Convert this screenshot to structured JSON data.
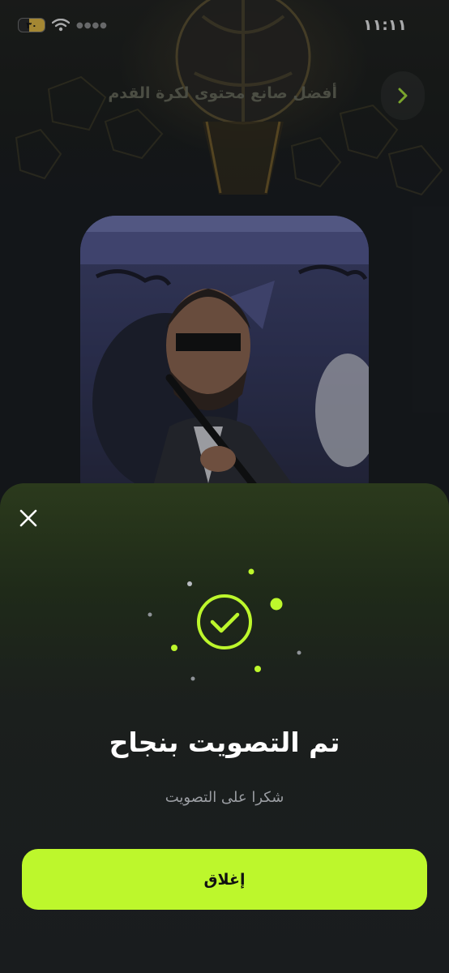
{
  "status_bar": {
    "time": "١١:١١",
    "battery": "٣٠",
    "signal_icon": "signal-dots-icon",
    "wifi_icon": "wifi-icon"
  },
  "page": {
    "title": "أفضل صانع محتوى لكرة القدم",
    "back_icon": "chevron-right-icon"
  },
  "modal": {
    "close_icon": "close-icon",
    "status_icon": "check-circle-icon",
    "title": "تم التصويت بنجاح",
    "subtitle": "شكرا على التصويت",
    "close_button_label": "إغلاق"
  },
  "colors": {
    "accent": "#bdf72c",
    "background": "#1a1d20",
    "text_primary": "#ffffff",
    "text_secondary": "#9a9da2"
  }
}
